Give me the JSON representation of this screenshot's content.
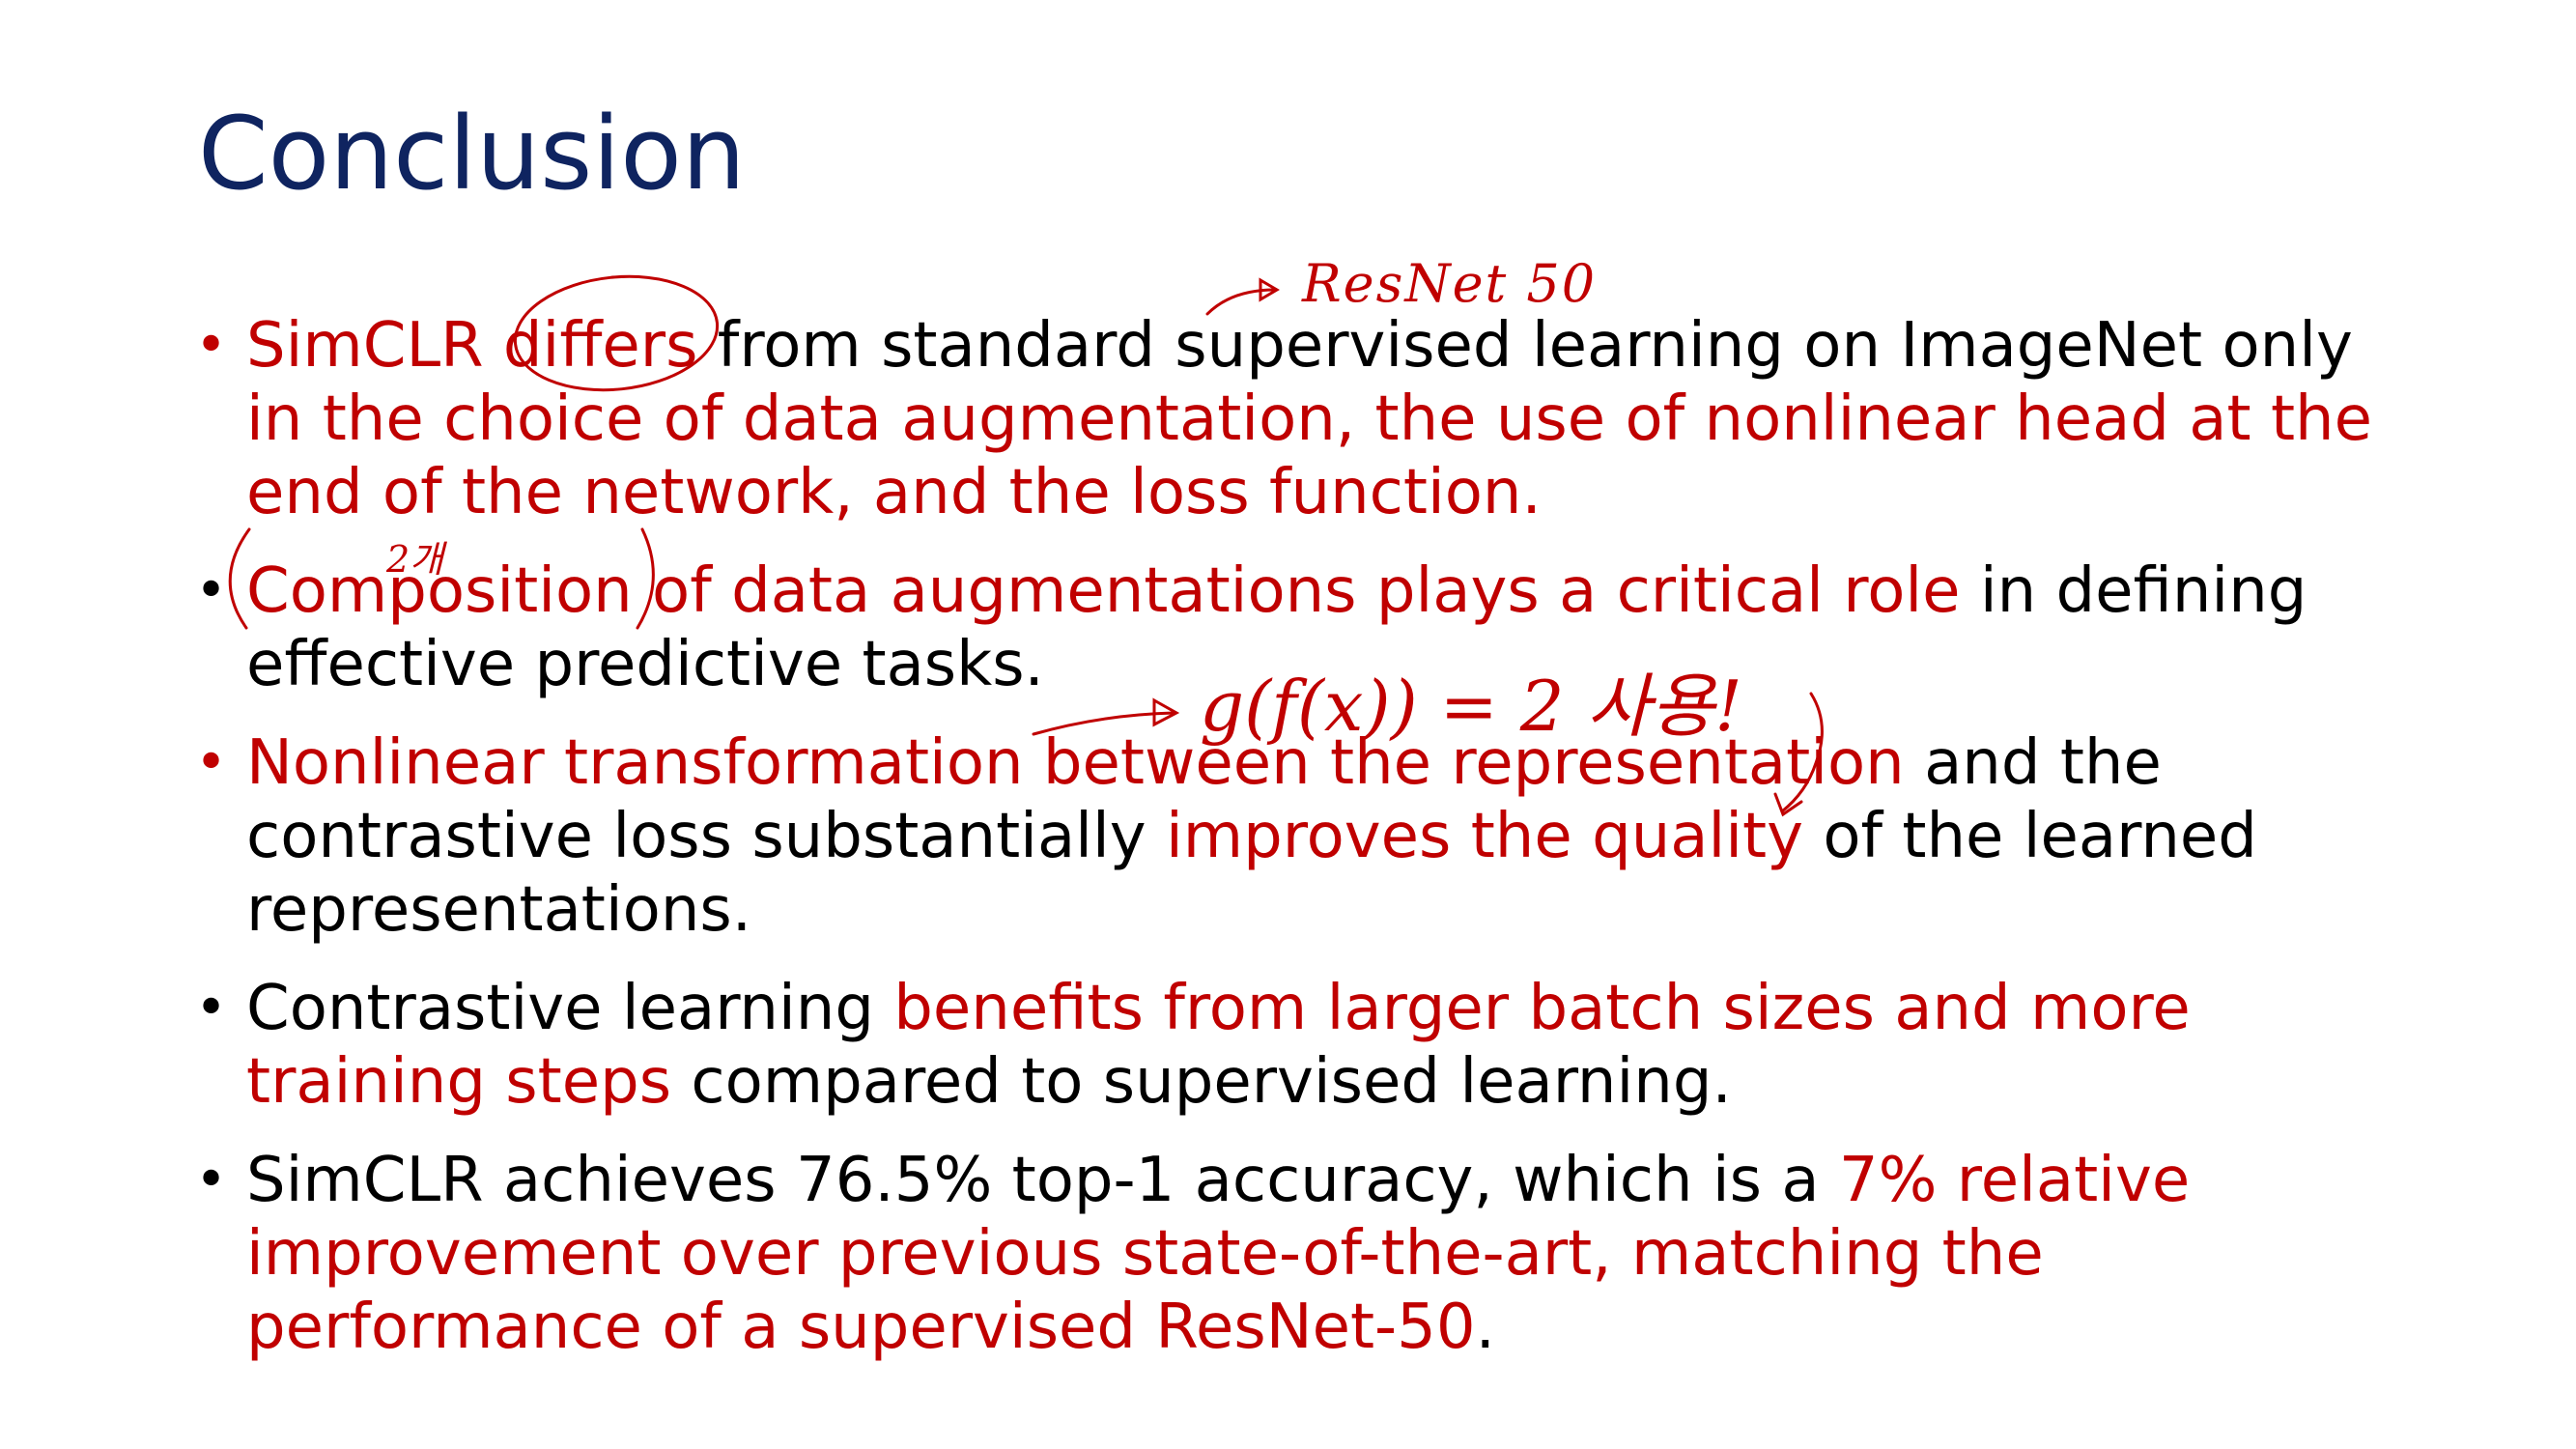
{
  "title": "Conclusion",
  "bullets": [
    {
      "marker_color": "#c00000",
      "segments": [
        {
          "text": "SimCLR differs",
          "hl": true
        },
        {
          "text": " from standard supervised learning on ImageNet only ",
          "hl": false
        },
        {
          "text": "in the choice of data augmentation, the use of nonlinear head at the end of the network, and the loss function.",
          "hl": true
        }
      ]
    },
    {
      "marker_color": "#000000",
      "segments": [
        {
          "text": "Composition of data augmentations plays a critical role",
          "hl": true
        },
        {
          "text": " in defining effective predictive tasks.",
          "hl": false
        }
      ]
    },
    {
      "marker_color": "#c00000",
      "segments": [
        {
          "text": "Nonlinear transformation between the representation",
          "hl": true
        },
        {
          "text": " and the contrastive loss substantially ",
          "hl": false
        },
        {
          "text": "improves the quality",
          "hl": true
        },
        {
          "text": " of the learned representations.",
          "hl": false
        }
      ]
    },
    {
      "marker_color": "#000000",
      "segments": [
        {
          "text": "Contrastive learning ",
          "hl": false
        },
        {
          "text": "benefits from larger batch sizes and more training steps",
          "hl": true
        },
        {
          "text": " compared to supervised learning.",
          "hl": false
        }
      ]
    },
    {
      "marker_color": "#000000",
      "segments": [
        {
          "text": "SimCLR achieves 76.5% top-1 accuracy, which is a ",
          "hl": false
        },
        {
          "text": "7% relative improvement over previous state-of-the-art, matching the performance of a supervised ResNet-50",
          "hl": true
        },
        {
          "text": ".",
          "hl": false
        }
      ]
    }
  ],
  "annotations": {
    "resnet": "ResNet 50",
    "composition_note": "2개",
    "gfx_note": "g(f(x)) = 2 사용!"
  },
  "colors": {
    "title": "#0f2460",
    "highlight": "#c00000",
    "body": "#000000",
    "ink": "#c00000"
  }
}
